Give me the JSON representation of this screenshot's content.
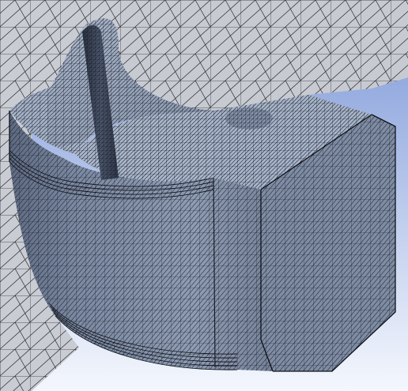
{
  "view": {
    "type": "finite-element-mesh-render",
    "object": "mesh-block",
    "mesh_style": "triangular-surface-mesh",
    "edge_color": "#1a1d24",
    "colors": {
      "background_top": "#7d98d8",
      "background_bottom": "#f4f7fd",
      "surrounding_mesh_face": "#c9ccd2",
      "mesh_face_light": "#b8c6d8",
      "mesh_face_mid": "#9aa9c0",
      "mesh_face_dark": "#56627a",
      "inflation_layer_lines": "#10131a"
    }
  }
}
